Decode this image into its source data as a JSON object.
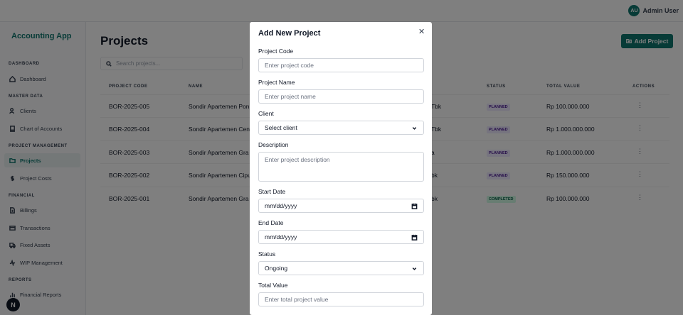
{
  "user": {
    "initials": "AU",
    "name": "Admin User"
  },
  "sidebar": {
    "brand": "Accounting App",
    "sections": [
      {
        "title": "DASHBOARD",
        "items": [
          {
            "label": "Dashboard",
            "icon": "home-icon"
          }
        ]
      },
      {
        "title": "MASTER DATA",
        "items": [
          {
            "label": "Clients",
            "icon": "users-icon"
          },
          {
            "label": "Chart of Accounts",
            "icon": "book-icon"
          }
        ]
      },
      {
        "title": "PROJECT MANAGEMENT",
        "items": [
          {
            "label": "Projects",
            "icon": "folder-icon",
            "active": true
          },
          {
            "label": "Project Costs",
            "icon": "dollar-icon"
          }
        ]
      },
      {
        "title": "FINANCIAL",
        "items": [
          {
            "label": "Billings",
            "icon": "file-icon"
          },
          {
            "label": "Transactions",
            "icon": "card-icon"
          },
          {
            "label": "Fixed Assets",
            "icon": "truck-icon"
          },
          {
            "label": "WIP Management",
            "icon": "activity-icon"
          }
        ]
      },
      {
        "title": "REPORTS",
        "items": [
          {
            "label": "Financial Reports",
            "icon": "bar-chart-icon"
          }
        ]
      }
    ]
  },
  "fab": {
    "label": "N"
  },
  "main": {
    "title": "Projects",
    "add_button": "Add Project",
    "search_placeholder": "Search projects...",
    "table": {
      "headers": {
        "code": "PROJECT CODE",
        "name": "NAME",
        "status": "STATUS",
        "value": "TOTAL VALUE",
        "actions": "ACTIONS"
      },
      "rows": [
        {
          "code": "BOR-2025-005",
          "name": "Sondir Apartemen Pon",
          "client_tail": "Tbk",
          "status": "PLANNED",
          "value": "Rp 100.000.000"
        },
        {
          "code": "BOR-2025-004",
          "name": "Sondir Apartemen Cen",
          "client_tail": "Tbk",
          "status": "PLANNED",
          "value": "Rp 1.000.000.000"
        },
        {
          "code": "BOR-2025-003",
          "name": "Sondir Apartemen Gra",
          "client_tail": "a",
          "status": "PLANNED",
          "value": "Rp 1.000.000.000"
        },
        {
          "code": "BOR-2025-002",
          "name": "Sondir Apartemen Cipu",
          "client_tail": "bk",
          "status": "PLANNED",
          "value": "Rp 150.000.000"
        },
        {
          "code": "BOR-2025-001",
          "name": "Sondir Apartemen Gra",
          "client_tail": "bk",
          "status": "COMPLETED",
          "value": "Rp 100.000.000"
        }
      ]
    }
  },
  "modal": {
    "title": "Add New Project",
    "fields": {
      "code": {
        "label": "Project Code",
        "placeholder": "Enter project code"
      },
      "name": {
        "label": "Project Name",
        "placeholder": "Enter project name"
      },
      "client": {
        "label": "Client",
        "value": "Select client"
      },
      "description": {
        "label": "Description",
        "placeholder": "Enter project description"
      },
      "start": {
        "label": "Start Date",
        "value": "mm/dd/yyyy"
      },
      "end": {
        "label": "End Date",
        "value": "mm/dd/yyyy"
      },
      "status": {
        "label": "Status",
        "value": "Ongoing"
      },
      "total": {
        "label": "Total Value",
        "placeholder": "Enter total project value"
      }
    }
  },
  "colors": {
    "accent": "#0f766e",
    "planned_badge": "#ede9fe",
    "completed_badge": "#d1fae5"
  }
}
